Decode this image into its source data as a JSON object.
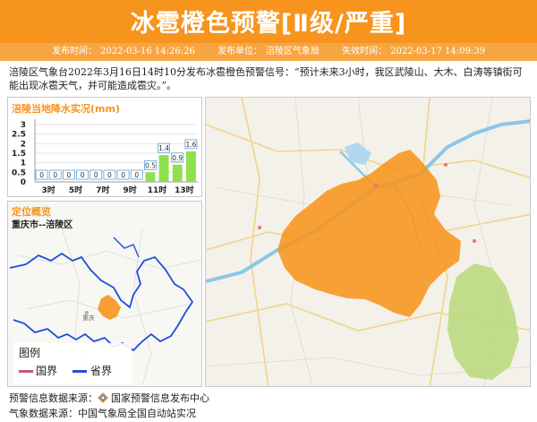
{
  "header": {
    "title": "冰雹橙色预警[Ⅱ级/严重]",
    "issue_time_label": "发布时间：",
    "issue_time": "2022-03-16 14:26:26",
    "unit_label": "发布单位：",
    "unit": "涪陵区气象局",
    "expire_label": "失效时间：",
    "expire_time": "2022-03-17 14:09:39"
  },
  "description": "涪陵区气象台2022年3月16日14时10分发布冰雹橙色预警信号：“预计未来3小时，我区武陵山、大木、白涛等镇街可能出现冰雹天气，并可能造成雹灾。”。",
  "rain_panel": {
    "title": "涪陵当地降水实况(mm)"
  },
  "chart_data": {
    "type": "bar",
    "title": "涪陵当地降水实况(mm)",
    "categories": [
      "3时",
      "",
      "5时",
      "",
      "7时",
      "",
      "9时",
      "",
      "11时",
      "",
      "13时",
      ""
    ],
    "values": [
      0,
      0,
      0,
      0,
      0,
      0,
      0,
      0,
      0.5,
      1.4,
      0.9,
      1.6
    ],
    "value_labels": [
      "0",
      "0",
      "0",
      "0",
      "0",
      "0",
      "0",
      "0",
      "0.5",
      "1.4",
      "0.9",
      "1.6"
    ],
    "y_ticks": [
      "0",
      "0.5",
      "1",
      "1.5",
      "2",
      "2.5",
      "3"
    ],
    "ylim": [
      0,
      3
    ],
    "grid": true,
    "bar_color": "#8ee04e",
    "label_border_color": "#5aa0d8"
  },
  "location_panel": {
    "title": "定位概览",
    "subtitle": "重庆市--涪陵区",
    "place_label": "重庆",
    "legend_title": "图例",
    "legend_items": [
      {
        "label": "国界",
        "color": "#c0597a"
      },
      {
        "label": "省界",
        "color": "#1e4fd8"
      }
    ]
  },
  "map": {
    "warning_color": "#f7941d",
    "river_color": "#8ac7e8",
    "green_area_color": "#b7d97a"
  },
  "footer": {
    "warning_source_label": "预警信息数据来源：",
    "warning_source": "国家预警信息发布中心",
    "weather_source_label": "气象数据来源：",
    "weather_source": "中国气象局全国自动站实况"
  },
  "colors": {
    "accent": "#f7941d",
    "accent_light": "#f7a543"
  }
}
